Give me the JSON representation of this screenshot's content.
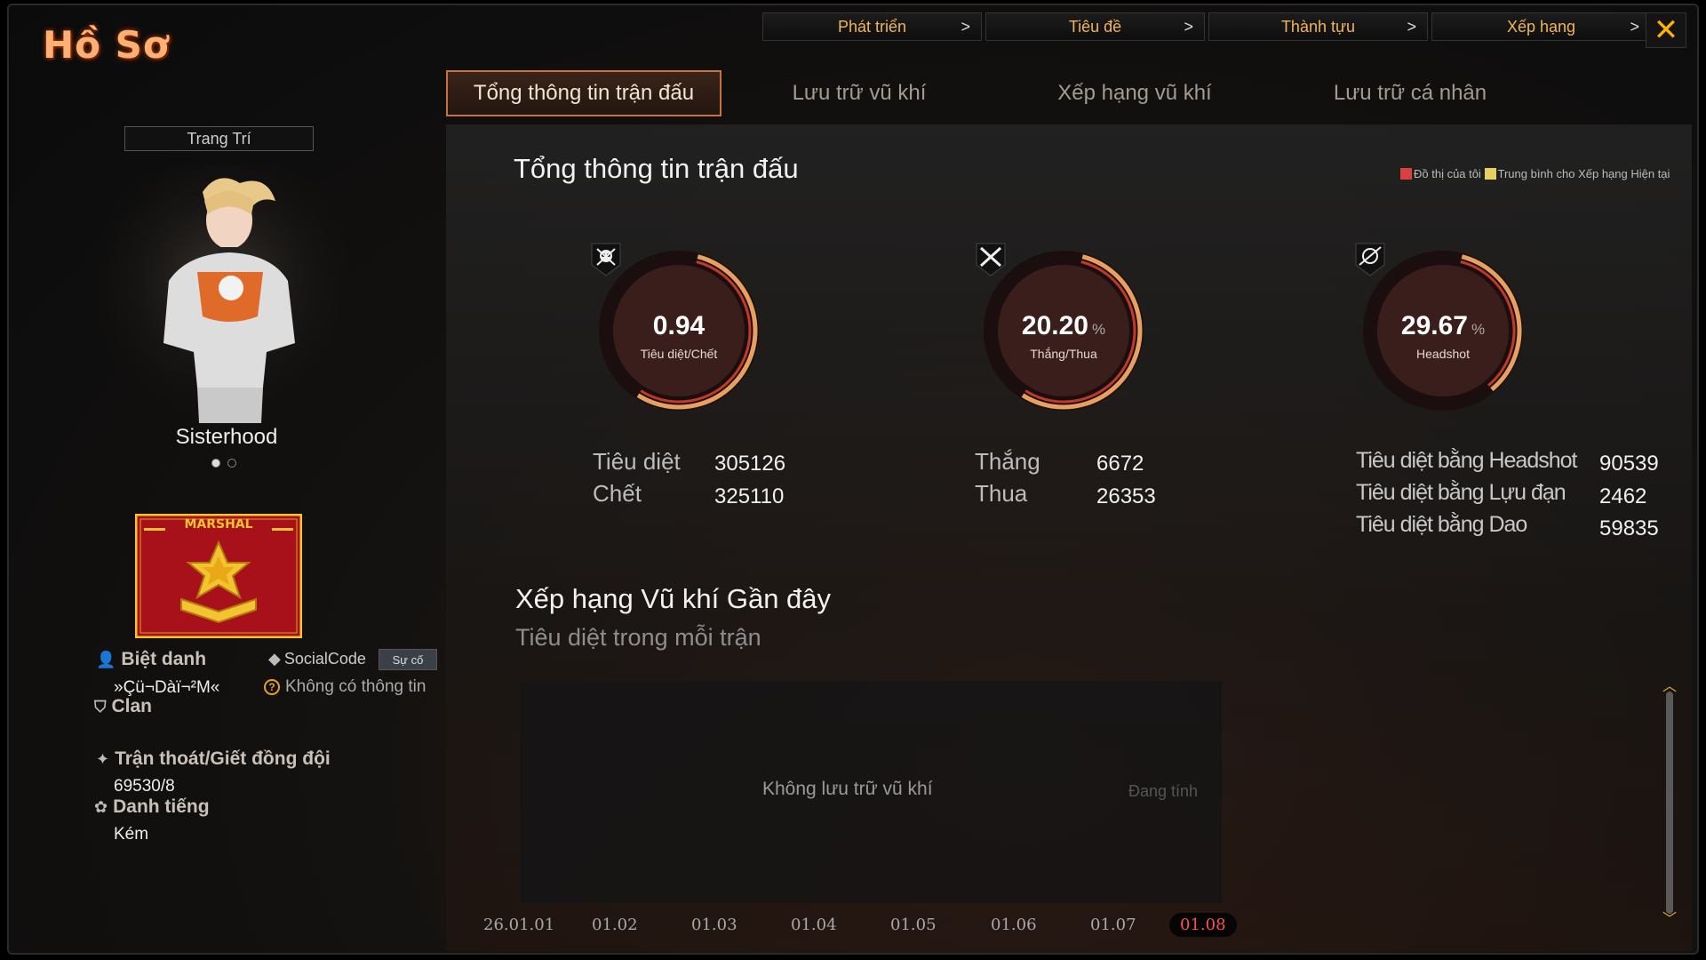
{
  "window": {
    "title": "Hồ Sơ"
  },
  "top_nav": [
    {
      "label": "Phát triển"
    },
    {
      "label": "Tiêu đề"
    },
    {
      "label": "Thành tựu"
    },
    {
      "label": "Xếp hạng"
    }
  ],
  "tabs": [
    {
      "label": "Tổng thông tin trận đấu",
      "active": true
    },
    {
      "label": "Lưu trữ vũ khí"
    },
    {
      "label": "Xếp hạng vũ khí"
    },
    {
      "label": "Lưu trữ cá nhân"
    }
  ],
  "profile": {
    "decor_button": "Trang Trí",
    "character_name": "Sisterhood",
    "rank_title": "MARSHAL",
    "nickname_label": "Biệt danh",
    "nickname": "»Çü¬Dàï¬²M«",
    "social_code_label": "SocialCode",
    "social_badge": "Sự cố",
    "social_value": "Không có thông tin",
    "clan_label": "Clan",
    "escape_label": "Trận thoát/Giết đồng đội",
    "escape_value": "69530/8",
    "reputation_label": "Danh tiếng",
    "reputation_value": "Kém"
  },
  "overview": {
    "title": "Tổng thông tin trận đấu",
    "legend_mine": "Đồ thị của tôi",
    "legend_avg": "Trung bình cho Xếp hạng Hiện tại",
    "gauges": [
      {
        "value": "0.94",
        "unit": "",
        "label": "Tiêu diệt/Chết",
        "icon": "skull-icon",
        "fill": 0.55
      },
      {
        "value": "20.20",
        "unit": "%",
        "label": "Thắng/Thua",
        "icon": "crossed-swords-icon",
        "fill": 0.55
      },
      {
        "value": "29.67",
        "unit": "%",
        "label": "Headshot",
        "icon": "crosshair-icon",
        "fill": 0.35
      }
    ],
    "kd": {
      "kills_label": "Tiêu diệt",
      "kills": "305126",
      "deaths_label": "Chết",
      "deaths": "325110"
    },
    "wl": {
      "wins_label": "Thắng",
      "wins": "6672",
      "losses_label": "Thua",
      "losses": "26353"
    },
    "hs": {
      "headshot_label": "Tiêu diệt bằng Headshot",
      "headshot": "90539",
      "grenade_label": "Tiêu diệt bằng Lựu đạn",
      "grenade": "2462",
      "knife_label": "Tiêu diệt bằng Dao",
      "knife": "59835"
    }
  },
  "recent": {
    "title": "Xếp hạng Vũ khí Gần đây",
    "subtitle": "Tiêu diệt trong mỗi trận",
    "empty_message": "Không lưu trữ vũ khí",
    "calculating": "Đang tính",
    "dates": [
      "26.01.01",
      "01.02",
      "01.03",
      "01.04",
      "01.05",
      "01.06",
      "01.07",
      "01.08"
    ],
    "active_date": "01.08"
  },
  "colors": {
    "accent": "#f0b45a",
    "gauge_fill": "#e8a060",
    "title": "#ffb074",
    "legend_mine": "#d94040",
    "legend_avg": "#e8d060"
  }
}
